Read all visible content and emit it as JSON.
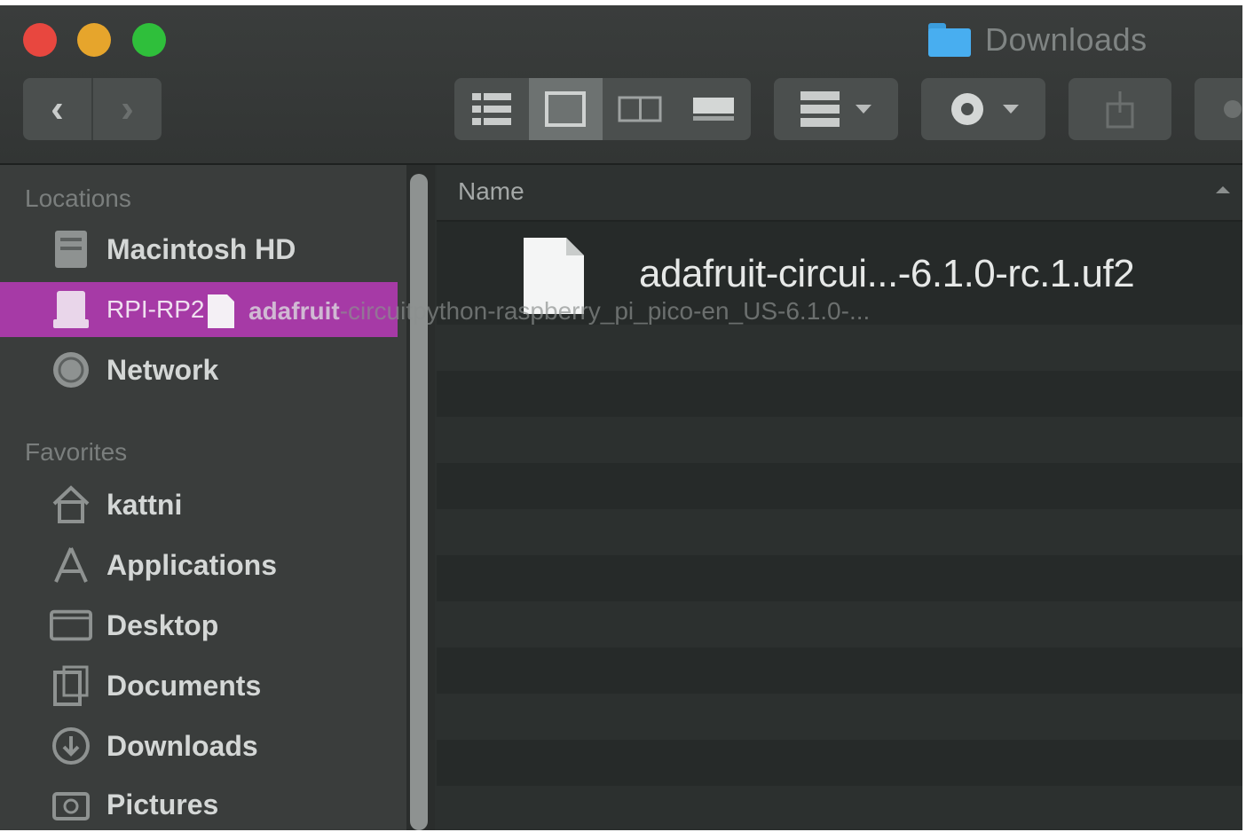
{
  "window": {
    "title": "Downloads",
    "title_icon": "folder-icon"
  },
  "toolbar": {
    "back_label": "‹",
    "forward_label": "›",
    "view_modes": [
      "list-view-icon",
      "icon-view-icon",
      "column-view-icon",
      "gallery-view-icon"
    ],
    "active_view": "icon-view-icon",
    "arrange_icon": "group-icon",
    "action_icon": "gear-icon",
    "share_icon": "share-icon"
  },
  "sidebar": {
    "locations_header": "Locations",
    "locations": [
      {
        "label": "Macintosh HD",
        "icon": "hard-drive-icon"
      },
      {
        "label": "RPI-RP2",
        "icon": "external-drive-icon",
        "selected": true
      },
      {
        "label": "Network",
        "icon": "network-globe-icon"
      }
    ],
    "favorites_header": "Favorites",
    "favorites": [
      {
        "label": "kattni",
        "icon": "home-icon"
      },
      {
        "label": "Applications",
        "icon": "applications-icon"
      },
      {
        "label": "Desktop",
        "icon": "desktop-icon"
      },
      {
        "label": "Documents",
        "icon": "documents-icon"
      },
      {
        "label": "Downloads",
        "icon": "downloads-icon"
      },
      {
        "label": "Pictures",
        "icon": "pictures-icon"
      }
    ]
  },
  "file_list": {
    "column_name": "Name",
    "files": [
      {
        "name": "adafruit-circui...-6.1.0-rc.1.uf2",
        "icon": "document-icon"
      }
    ]
  },
  "drag": {
    "label": "adafruit",
    "tail": "-circuitpython-raspberry_pi_pico-en_US-6.1.0-..."
  },
  "colors": {
    "selection": "#a63aa6",
    "folder": "#48aef0"
  }
}
